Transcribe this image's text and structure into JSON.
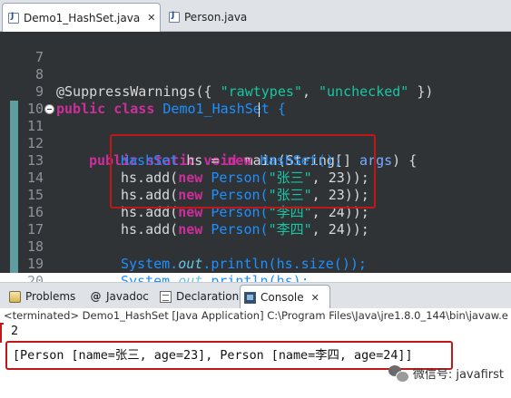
{
  "editor_tabs": [
    {
      "label": "Demo1_HashSet.java",
      "active": true
    },
    {
      "label": "Person.java",
      "active": false
    }
  ],
  "code_lines": [
    {
      "num": "7"
    },
    {
      "num": "8",
      "annotation": "@SuppressWarnings({ ",
      "s1": "\"rawtypes\"",
      "mid": ", ",
      "s2": "\"unchecked\"",
      "end": " })"
    },
    {
      "num": "9",
      "kw": "public class ",
      "name": "Demo1_HashSet {"
    },
    {
      "num": "10"
    },
    {
      "num": "11",
      "kw": "public static void ",
      "method": "main",
      "rest": "(String[] ",
      "param": "args",
      "end": ") {"
    },
    {
      "num": "12",
      "t1": "HashSet ",
      "t2": "hs",
      "t3": " = ",
      "kw": "new ",
      "t4": "HashSet();"
    },
    {
      "num": "13",
      "pre": "hs.add(",
      "kw": "new ",
      "cls": "Person(",
      "str": "\"张三\"",
      "mid": ", ",
      "n": "23",
      "end": "));"
    },
    {
      "num": "14",
      "pre": "hs.add(",
      "kw": "new ",
      "cls": "Person(",
      "str": "\"张三\"",
      "mid": ", ",
      "n": "23",
      "end": "));"
    },
    {
      "num": "15",
      "pre": "hs.add(",
      "kw": "new ",
      "cls": "Person(",
      "str": "\"李四\"",
      "mid": ", ",
      "n": "24",
      "end": "));"
    },
    {
      "num": "16",
      "pre": "hs.add(",
      "kw": "new ",
      "cls": "Person(",
      "str": "\"李四\"",
      "mid": ", ",
      "n": "24",
      "end": "));"
    },
    {
      "num": "17"
    },
    {
      "num": "18",
      "pre": "System.",
      "fld": "out",
      "end": ".println(hs.size());"
    },
    {
      "num": "19",
      "pre": "System.",
      "fld": "out",
      "end": ".println(hs);"
    },
    {
      "num": "20",
      "end": "}"
    }
  ],
  "view_tabs": [
    {
      "label": "Problems"
    },
    {
      "label": "Javadoc"
    },
    {
      "label": "Declaration"
    },
    {
      "label": "Console",
      "active": true
    }
  ],
  "console": {
    "terminated": "<terminated> Demo1_HashSet [Java Application] C:\\Program Files\\Java\\jre1.8.0_144\\bin\\javaw.e",
    "line1": "2",
    "line2": "[Person [name=张三, age=23], Person [name=李四, age=24]]"
  },
  "watermark": "微信号: javafirst",
  "colors": {
    "editor_bg": "#2f3336",
    "keyword": "#cc2e9c",
    "string": "#17c6a3",
    "class": "#1e90ff",
    "highlight_box": "#c01818"
  }
}
